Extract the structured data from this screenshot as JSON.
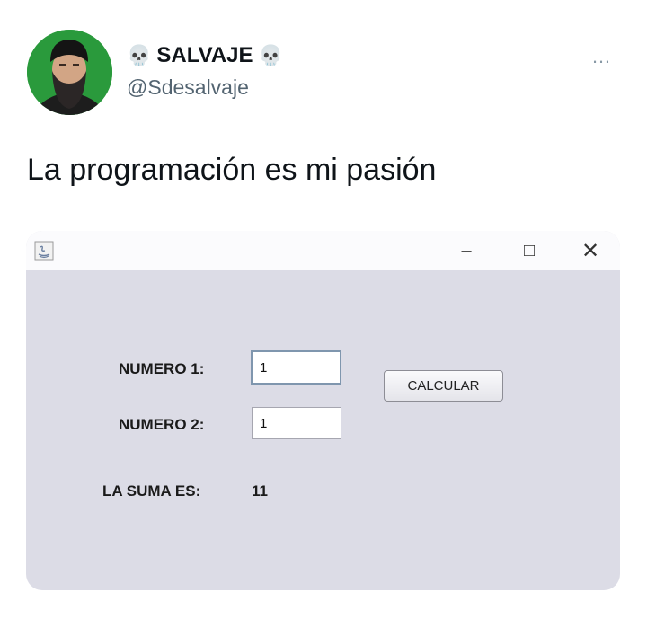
{
  "tweet": {
    "display_name": "SALVAJE",
    "name_emoji": "💀",
    "handle": "@Sdesalvaje",
    "more_icon": "…",
    "text": "La programación es mi pasión",
    "avatar_bg": "#2a9a3c"
  },
  "window": {
    "app_icon": "java-app-icon",
    "controls": {
      "minimize": "–",
      "maximize": "□",
      "close": "✕"
    },
    "numero1_label": "NUMERO 1:",
    "numero1_value": "1",
    "numero2_label": "NUMERO 2:",
    "numero2_value": "1",
    "calcular_label": "CALCULAR",
    "suma_label": "LA SUMA ES:",
    "suma_value": "11",
    "background": "#dcdce6"
  }
}
